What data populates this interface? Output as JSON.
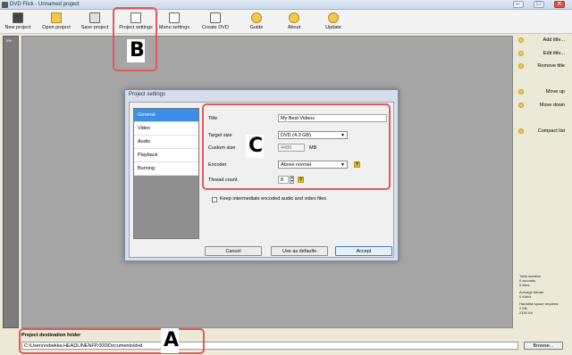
{
  "window": {
    "title": "DVD Flick - Unnamed project",
    "minimize_glyph": "–",
    "maximize_glyph": "□",
    "close_glyph": "✕"
  },
  "toolbar": {
    "items": [
      {
        "label": "New project",
        "icon": "new-project-icon"
      },
      {
        "label": "Open project",
        "icon": "folder-icon"
      },
      {
        "label": "Save project",
        "icon": "save-icon"
      },
      {
        "label": "Project settings",
        "icon": "project-settings-icon"
      },
      {
        "label": "Menu settings",
        "icon": "menu-settings-icon"
      },
      {
        "label": "Create DVD",
        "icon": "create-dvd-icon"
      },
      {
        "label": "Guide",
        "icon": "guide-icon"
      },
      {
        "label": "About",
        "icon": "about-icon"
      },
      {
        "label": "Update",
        "icon": "update-icon"
      }
    ]
  },
  "left_strip": {
    "percent": "0%"
  },
  "side_panel": {
    "items": [
      {
        "label": "Add title...",
        "icon": "add-icon"
      },
      {
        "label": "Edit title...",
        "icon": "edit-icon"
      },
      {
        "label": "Remove title",
        "icon": "remove-icon"
      },
      {
        "label": "Move up",
        "icon": "arrow-up-icon"
      },
      {
        "label": "Move down",
        "icon": "arrow-down-icon"
      },
      {
        "label": "Compact list",
        "icon": "compact-list-icon"
      }
    ],
    "stats": {
      "total_duration_label": "Total duration",
      "total_duration_value": "0 seconds",
      "titles_value": "0 titles",
      "avg_bitrate_label": "Average bitrate",
      "avg_bitrate_value": "0 Kbit/s",
      "hdd_space_label": "Harddisk space required",
      "hdd_space_mb": "2 Mb",
      "hdd_space_kb": "2150 Kb"
    }
  },
  "destination": {
    "label": "Project destination folder",
    "value": "C:\\Users\\rebekka.HEADLINENFP.000\\Documents\\dvd",
    "browse_label": "Browse..."
  },
  "dialog": {
    "title": "Project settings",
    "tabs": [
      "General",
      "Video",
      "Audio",
      "Playback",
      "Burning"
    ],
    "active_tab": "General",
    "fields": {
      "title_label": "Title",
      "title_value": "My Best Videos",
      "target_size_label": "Target size",
      "target_size_value": "DVD (4.3 GB)",
      "custom_size_label": "Custom size",
      "custom_size_value": "4489",
      "custom_size_unit": "MB",
      "encoder_label": "Encoder",
      "encoder_value": "Above normal",
      "thread_count_label": "Thread count",
      "thread_count_value": "8"
    },
    "checkbox_label": "Keep intermediate encoded audio and video files",
    "buttons": {
      "cancel": "Cancel",
      "use_as_defaults": "Use as defaults",
      "accept": "Accept"
    }
  },
  "annotations": {
    "a": "A",
    "b": "B",
    "c": "C"
  },
  "colors": {
    "highlight_red": "#e25a5a",
    "selected_tab": "#3a8ee6",
    "canvas_gray": "#a5a5a5"
  }
}
